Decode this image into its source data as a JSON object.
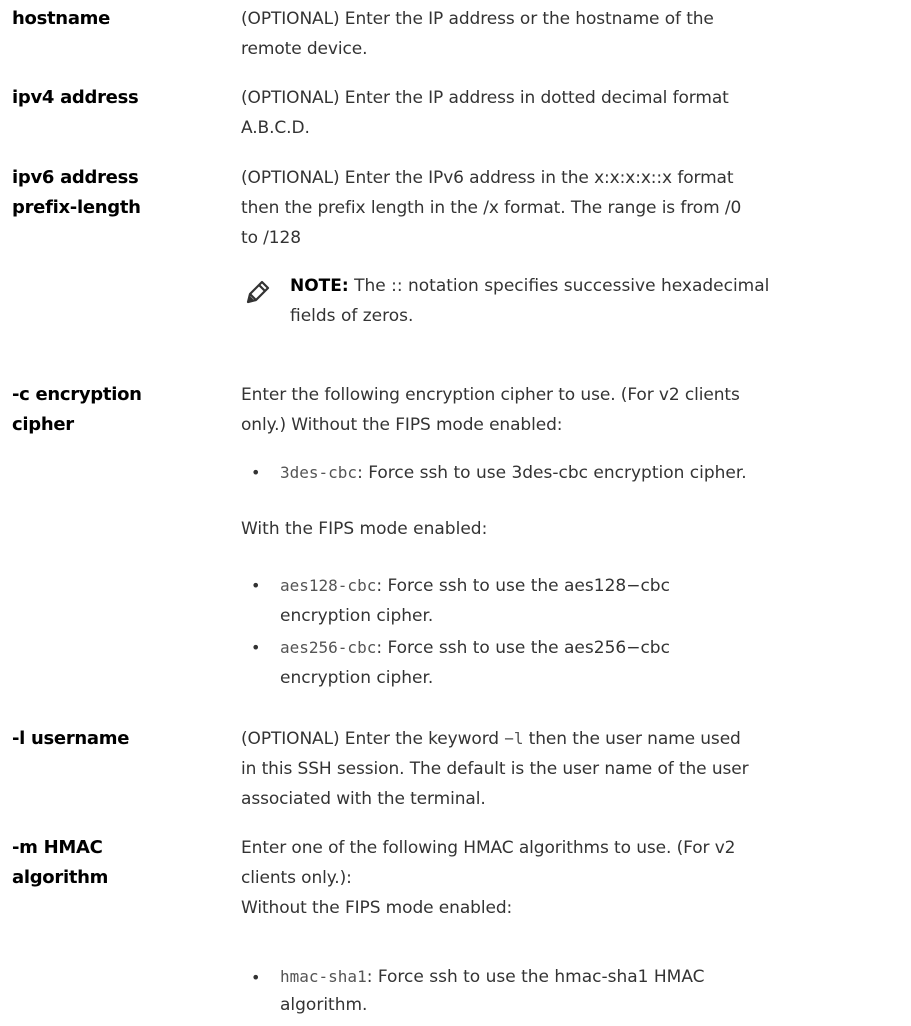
{
  "params": [
    {
      "term": [
        "hostname"
      ],
      "definition": [
        "(OPTIONAL) Enter the IP address or the hostname of the",
        "remote device."
      ]
    },
    {
      "term": [
        "ipv4 address"
      ],
      "definition": [
        "(OPTIONAL) Enter the IP address in dotted decimal format",
        "A.B.C.D."
      ]
    },
    {
      "term": [
        "ipv6 address",
        "prefix-length"
      ],
      "definition": [
        "(OPTIONAL) Enter the IPv6 address in the x:x:x:x::x format",
        "then the prefix length in the /x format. The range is from /0",
        "to /128"
      ],
      "note": {
        "label": "NOTE:",
        "lines": [
          " The :: notation specifies successive hexadecimal",
          "fields of zeros."
        ],
        "icon": "pencil-note-icon"
      }
    },
    {
      "term": [
        "-c encryption",
        "cipher"
      ],
      "definition": [
        "Enter the following encryption cipher to use. (For v2 clients",
        "only.) Without the FIPS mode enabled:"
      ],
      "bullets_a": [
        {
          "code": "3des-cbc",
          "text": ": Force ssh to use 3des-cbc encryption cipher.",
          "text2": ""
        }
      ],
      "mid_para": "With the FIPS mode enabled:",
      "bullets_b": [
        {
          "code": "aes128-cbc",
          "text": ": Force ssh to use the aes128−cbc",
          "text2": "encryption cipher."
        },
        {
          "code": "aes256-cbc",
          "text": ": Force ssh to use the aes256−cbc",
          "text2": "encryption cipher."
        }
      ]
    },
    {
      "term": [
        "-l username"
      ],
      "definition_pre": "(OPTIONAL) Enter the keyword ",
      "definition_code": "−l",
      "definition_post": " then the user name used",
      "definition": [
        "in this SSH session. The default is the user name of the user",
        "associated with the terminal."
      ]
    },
    {
      "term": [
        "-m HMAC",
        "algorithm"
      ],
      "definition": [
        "Enter one of the following HMAC algorithms to use. (For v2",
        "clients only.):",
        "Without the FIPS mode enabled:"
      ],
      "bullets": [
        {
          "code": "hmac-sha1",
          "text": ": Force ssh to use the hmac-sha1 HMAC",
          "text2": "algorithm."
        }
      ]
    }
  ]
}
